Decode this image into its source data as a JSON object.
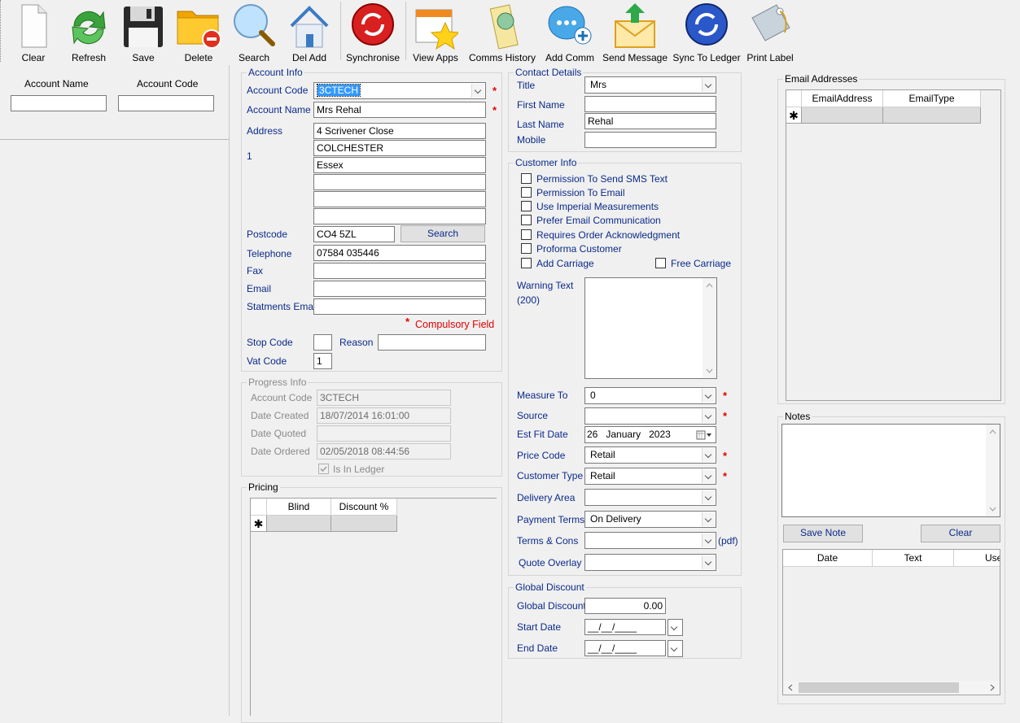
{
  "toolbar": {
    "clear": "Clear",
    "refresh": "Refresh",
    "save": "Save",
    "delete": "Delete",
    "search": "Search",
    "del_add": "Del Add",
    "synchronise": "Synchronise",
    "view_apps": "View Apps",
    "comms_history": "Comms History",
    "add_comm": "Add Comm",
    "send_message": "Send Message",
    "sync_to_ledger": "Sync To Ledger",
    "print_label": "Print Label"
  },
  "left_search": {
    "account_name_label": "Account Name",
    "account_code_label": "Account Code",
    "account_name_value": "",
    "account_code_value": ""
  },
  "account_info": {
    "title": "Account Info",
    "account_code_label": "Account Code",
    "account_code": "3CTECH",
    "account_name_label": "Account Name",
    "account_name": "Mrs Rehal",
    "address_label": "Address",
    "address_index": "1",
    "address_lines": [
      "4 Scrivener Close",
      "COLCHESTER",
      "Essex",
      "",
      "",
      ""
    ],
    "postcode_label": "Postcode",
    "postcode": "CO4 5ZL",
    "search_button": "Search",
    "telephone_label": "Telephone",
    "telephone": "07584 035446",
    "fax_label": "Fax",
    "fax": "",
    "email_label": "Email",
    "email": "",
    "statements_email_label": "Statments Email",
    "statements_email": "",
    "compulsory_star": "*",
    "compulsory_label": "Compulsory Field",
    "stop_code_label": "Stop Code",
    "stop_code": "",
    "reason_label": "Reason",
    "reason": "",
    "vat_code_label": "Vat Code",
    "vat_code": "1"
  },
  "progress_info": {
    "title": "Progress Info",
    "account_code_label": "Account Code",
    "account_code": "3CTECH",
    "date_created_label": "Date Created",
    "date_created": "18/07/2014 16:01:00",
    "date_quoted_label": "Date Quoted",
    "date_quoted": "",
    "date_ordered_label": "Date Ordered",
    "date_ordered": "02/05/2018 08:44:56",
    "is_in_ledger_label": "Is In Ledger",
    "is_in_ledger": true
  },
  "pricing": {
    "title": "Pricing",
    "columns": [
      "Blind",
      "Discount %"
    ],
    "new_row_marker": "✱"
  },
  "contact_details": {
    "title": "Contact Details",
    "title_label": "Title",
    "title_value": "Mrs",
    "first_name_label": "First Name",
    "first_name": "",
    "last_name_label": "Last Name",
    "last_name": "Rehal",
    "mobile_label": "Mobile",
    "mobile": ""
  },
  "customer_info": {
    "title": "Customer Info",
    "checkboxes": [
      {
        "label": "Permission To Send SMS Text",
        "checked": false
      },
      {
        "label": "Permission To Email",
        "checked": false
      },
      {
        "label": "Use Imperial Measurements",
        "checked": false
      },
      {
        "label": "Prefer Email Communication",
        "checked": false
      },
      {
        "label": "Requires Order Acknowledgment",
        "checked": false
      },
      {
        "label": "Proforma Customer",
        "checked": false
      },
      {
        "label": "Add Carriage",
        "checked": false
      }
    ],
    "free_carriage": {
      "label": "Free Carriage",
      "checked": false
    },
    "warning_text_label": "Warning Text",
    "warning_text_limit": "(200)",
    "warning_text": "",
    "measure_to_label": "Measure To",
    "measure_to": "0",
    "source_label": "Source",
    "source": "",
    "est_fit_date_label": "Est Fit Date",
    "est_fit_day": "26",
    "est_fit_month": "January",
    "est_fit_year": "2023",
    "price_code_label": "Price Code",
    "price_code": "Retail",
    "customer_type_label": "Customer Type",
    "customer_type": "Retail",
    "delivery_area_label": "Delivery Area",
    "delivery_area": "",
    "payment_terms_label": "Payment Terms",
    "payment_terms": "On Delivery",
    "terms_cons_label": "Terms & Cons",
    "terms_cons": "",
    "pdf_label": "(pdf)",
    "quote_overlay_label": "Quote Overlay",
    "quote_overlay": ""
  },
  "global_discount": {
    "title": "Global Discount",
    "global_discount_label": "Global Discount",
    "global_discount": "0.00",
    "start_date_label": "Start Date",
    "start_date": "__/__/____",
    "end_date_label": "End Date",
    "end_date": "__/__/____"
  },
  "email_addresses": {
    "title": "Email Addresses",
    "columns": [
      "EmailAddress",
      "EmailType"
    ],
    "new_row_marker": "✱"
  },
  "notes": {
    "title": "Notes",
    "text": "",
    "save_note_button": "Save Note",
    "clear_button": "Clear",
    "columns": [
      "Date",
      "Text",
      "Use"
    ]
  },
  "colors": {
    "label_blue": "#0a2a8a",
    "required_red": "#e00000",
    "selection_blue": "#3399ff"
  }
}
